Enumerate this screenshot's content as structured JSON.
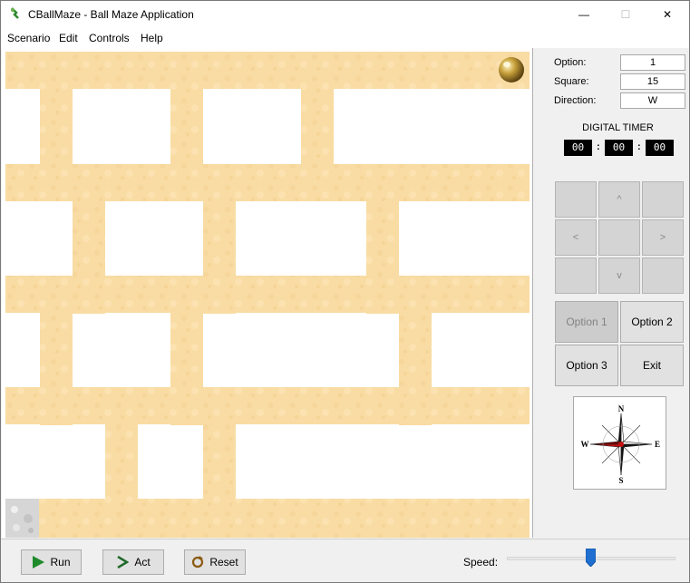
{
  "window": {
    "title": "CBallMaze - Ball Maze Application",
    "controls": {
      "minimize": "—",
      "maximize": "☐",
      "close": "✕"
    }
  },
  "menu": {
    "items": [
      "Scenario",
      "Edit",
      "Controls",
      "Help"
    ]
  },
  "info": {
    "option_label": "Option:",
    "option_value": "1",
    "square_label": "Square:",
    "square_value": "15",
    "direction_label": "Direction:",
    "direction_value": "W"
  },
  "timer": {
    "title": "DIGITAL TIMER",
    "hours": "00",
    "minutes": "00",
    "seconds": "00",
    "separator": ":"
  },
  "dpad": {
    "up": "^",
    "left": "<",
    "right": ">",
    "down": "v"
  },
  "options": {
    "option1": "Option 1",
    "option2": "Option 2",
    "option3": "Option 3",
    "exit": "Exit"
  },
  "compass": {
    "N": "N",
    "S": "S",
    "E": "E",
    "W": "W"
  },
  "bottom": {
    "run": "Run",
    "act": "Act",
    "reset": "Reset",
    "speed_label": "Speed:",
    "speed_level": 0.5
  },
  "colors": {
    "sand": "#f9dca3",
    "accent_red": "#c41010",
    "slider_blue": "#1e6fd0",
    "run_green": "#1f8a2a"
  },
  "icons": {
    "app": "ball-maze-icon",
    "run": "play-triangle-icon",
    "act": "arrow-right-icon",
    "reset": "reset-icon",
    "ball": "gold-ball-icon",
    "goal": "goal-square-icon"
  }
}
